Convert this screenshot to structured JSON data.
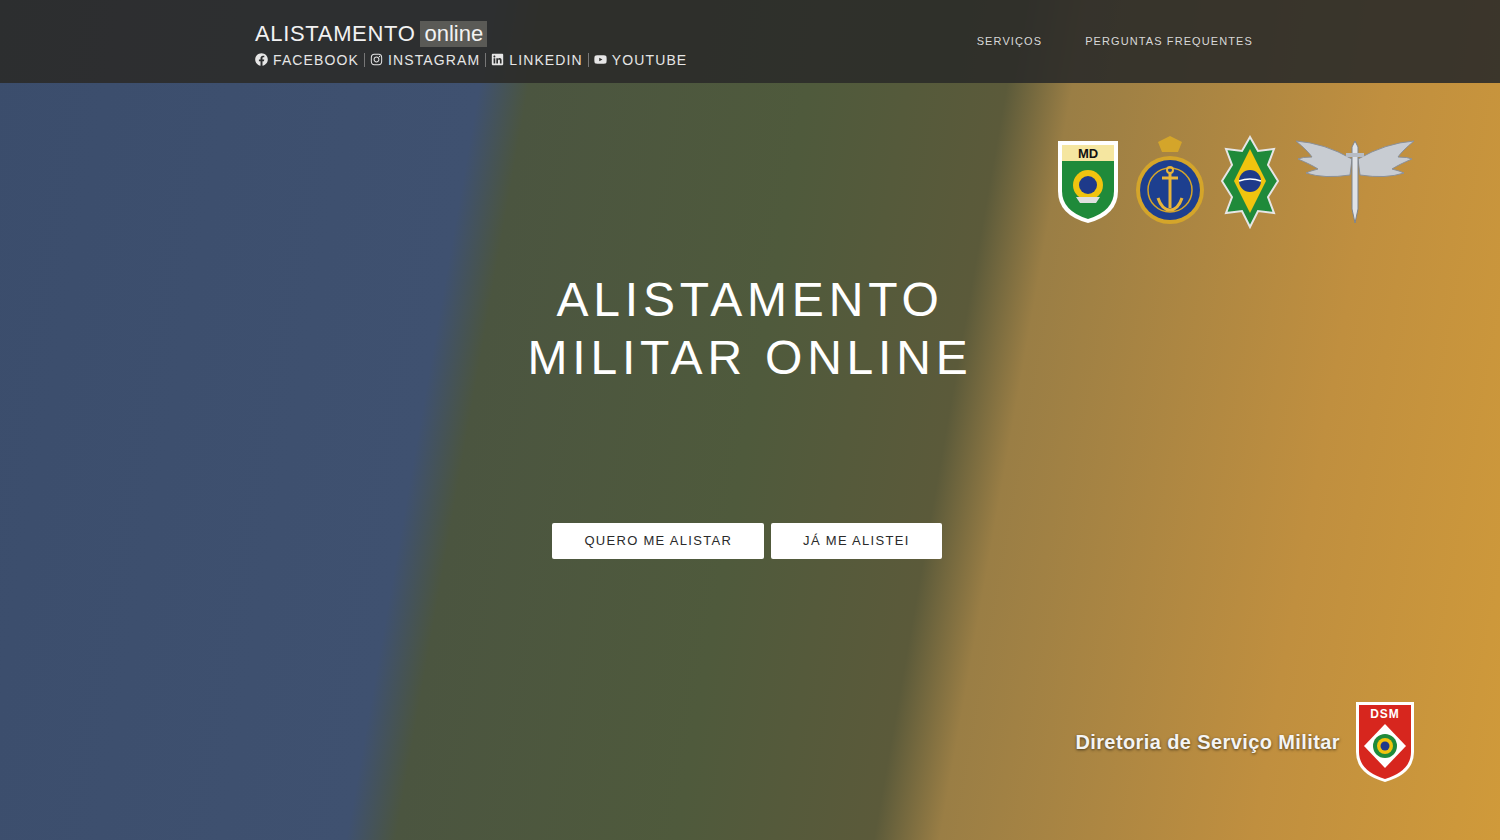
{
  "header": {
    "brand": "ALISTAMENTO",
    "brand_tag": "online",
    "social": [
      "FACEBOOK",
      "INSTAGRAM",
      "LINKEDIN",
      "YOUTUBE"
    ],
    "nav": [
      "SERVIÇOS",
      "PERGUNTAS FREQUENTES"
    ]
  },
  "emblems": [
    {
      "kind": "md",
      "label": "MD"
    },
    {
      "kind": "navy"
    },
    {
      "kind": "army"
    },
    {
      "kind": "air"
    }
  ],
  "hero": {
    "title_lines": [
      "ALISTAMENTO",
      "MILITAR ONLINE"
    ],
    "buttons": [
      "QUERO ME ALISTAR",
      "JÁ ME ALISTEI"
    ]
  },
  "footer": {
    "org": "Diretoria de Serviço Militar",
    "logo_label": "DSM"
  }
}
